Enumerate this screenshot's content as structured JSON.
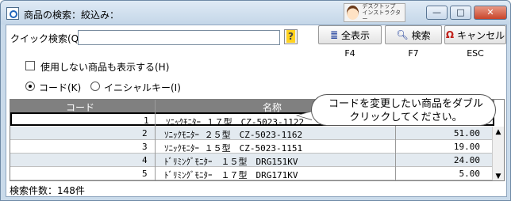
{
  "window": {
    "title": "商品の検索：絞込み：",
    "instructor_badge": [
      "デスクトップ",
      "インストラクター"
    ],
    "min_label": "—",
    "max_label": "□",
    "close_label": "✕"
  },
  "toolbar": {
    "quick_search_label": "クイック検索(Q)",
    "quick_search_value": "",
    "show_all_label": "全表示",
    "show_all_key": "F4",
    "search_label": "検索",
    "search_key": "F7",
    "cancel_label": "キャンセル",
    "cancel_key": "ESC"
  },
  "options": {
    "show_unused_label": "使用しない商品も表示する(H)",
    "radio_code_label": "コード(K)",
    "radio_initial_label": "イニシャルキー(I)"
  },
  "grid": {
    "columns": [
      "コード",
      "名称"
    ],
    "rows": [
      {
        "code": "1",
        "name": "ｿﾆｯｸﾓﾆﾀｰ １７型　CZ-5023-1122",
        "value": ""
      },
      {
        "code": "2",
        "name": "ｿﾆｯｸﾓﾆﾀｰ ２５型　CZ-5023-1162",
        "value": "51.00"
      },
      {
        "code": "3",
        "name": "ｿﾆｯｸﾓﾆﾀｰ １５型　CZ-5023-1151",
        "value": "19.00"
      },
      {
        "code": "4",
        "name": "ﾄﾞﾘﾐﾝｸﾞﾓﾆﾀｰ　１５型　DRG151KV",
        "value": "24.00"
      },
      {
        "code": "5",
        "name": "ﾄﾞﾘﾐﾝｸﾞﾓﾆﾀｰ　１７型　DRG171KV",
        "value": "5.00"
      }
    ]
  },
  "status": {
    "count_text": "検索件数：148件"
  },
  "callout": {
    "text": "コードを変更したい商品をダブルクリックしてください。"
  }
}
